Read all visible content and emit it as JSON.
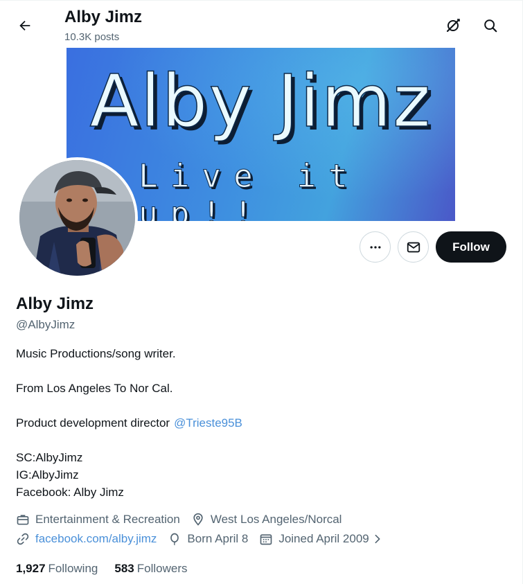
{
  "header": {
    "title": "Alby Jimz",
    "posts_count": "10.3K posts"
  },
  "banner": {
    "title": "Alby Jimz",
    "subtitle": "Live it up!!"
  },
  "actions": {
    "more_icon": "more-icon",
    "message_icon": "mail-icon",
    "follow_label": "Follow"
  },
  "profile": {
    "name": "Alby Jimz",
    "handle": "@AlbyJimz",
    "bio": {
      "line1": "Music Productions/song writer.",
      "line2": "From Los Angeles To Nor Cal.",
      "line3": "Product development director",
      "mention": "@Trieste95B",
      "line4": "SC:AlbyJimz",
      "line5": "IG:AlbyJimz",
      "line6": "Facebook: Alby Jimz"
    },
    "category": "Entertainment & Recreation",
    "location": "West Los Angeles/Norcal",
    "website": "facebook.com/alby.jimz",
    "birthday": "Born April 8",
    "joined": "Joined April 2009"
  },
  "stats": {
    "following_count": "1,927",
    "following_label": "Following",
    "followers_count": "583",
    "followers_label": "Followers"
  },
  "colors": {
    "link": "#4a90d9",
    "secondary_text": "#536471",
    "primary_text": "#0f1419",
    "follow_bg": "#0f1419"
  }
}
